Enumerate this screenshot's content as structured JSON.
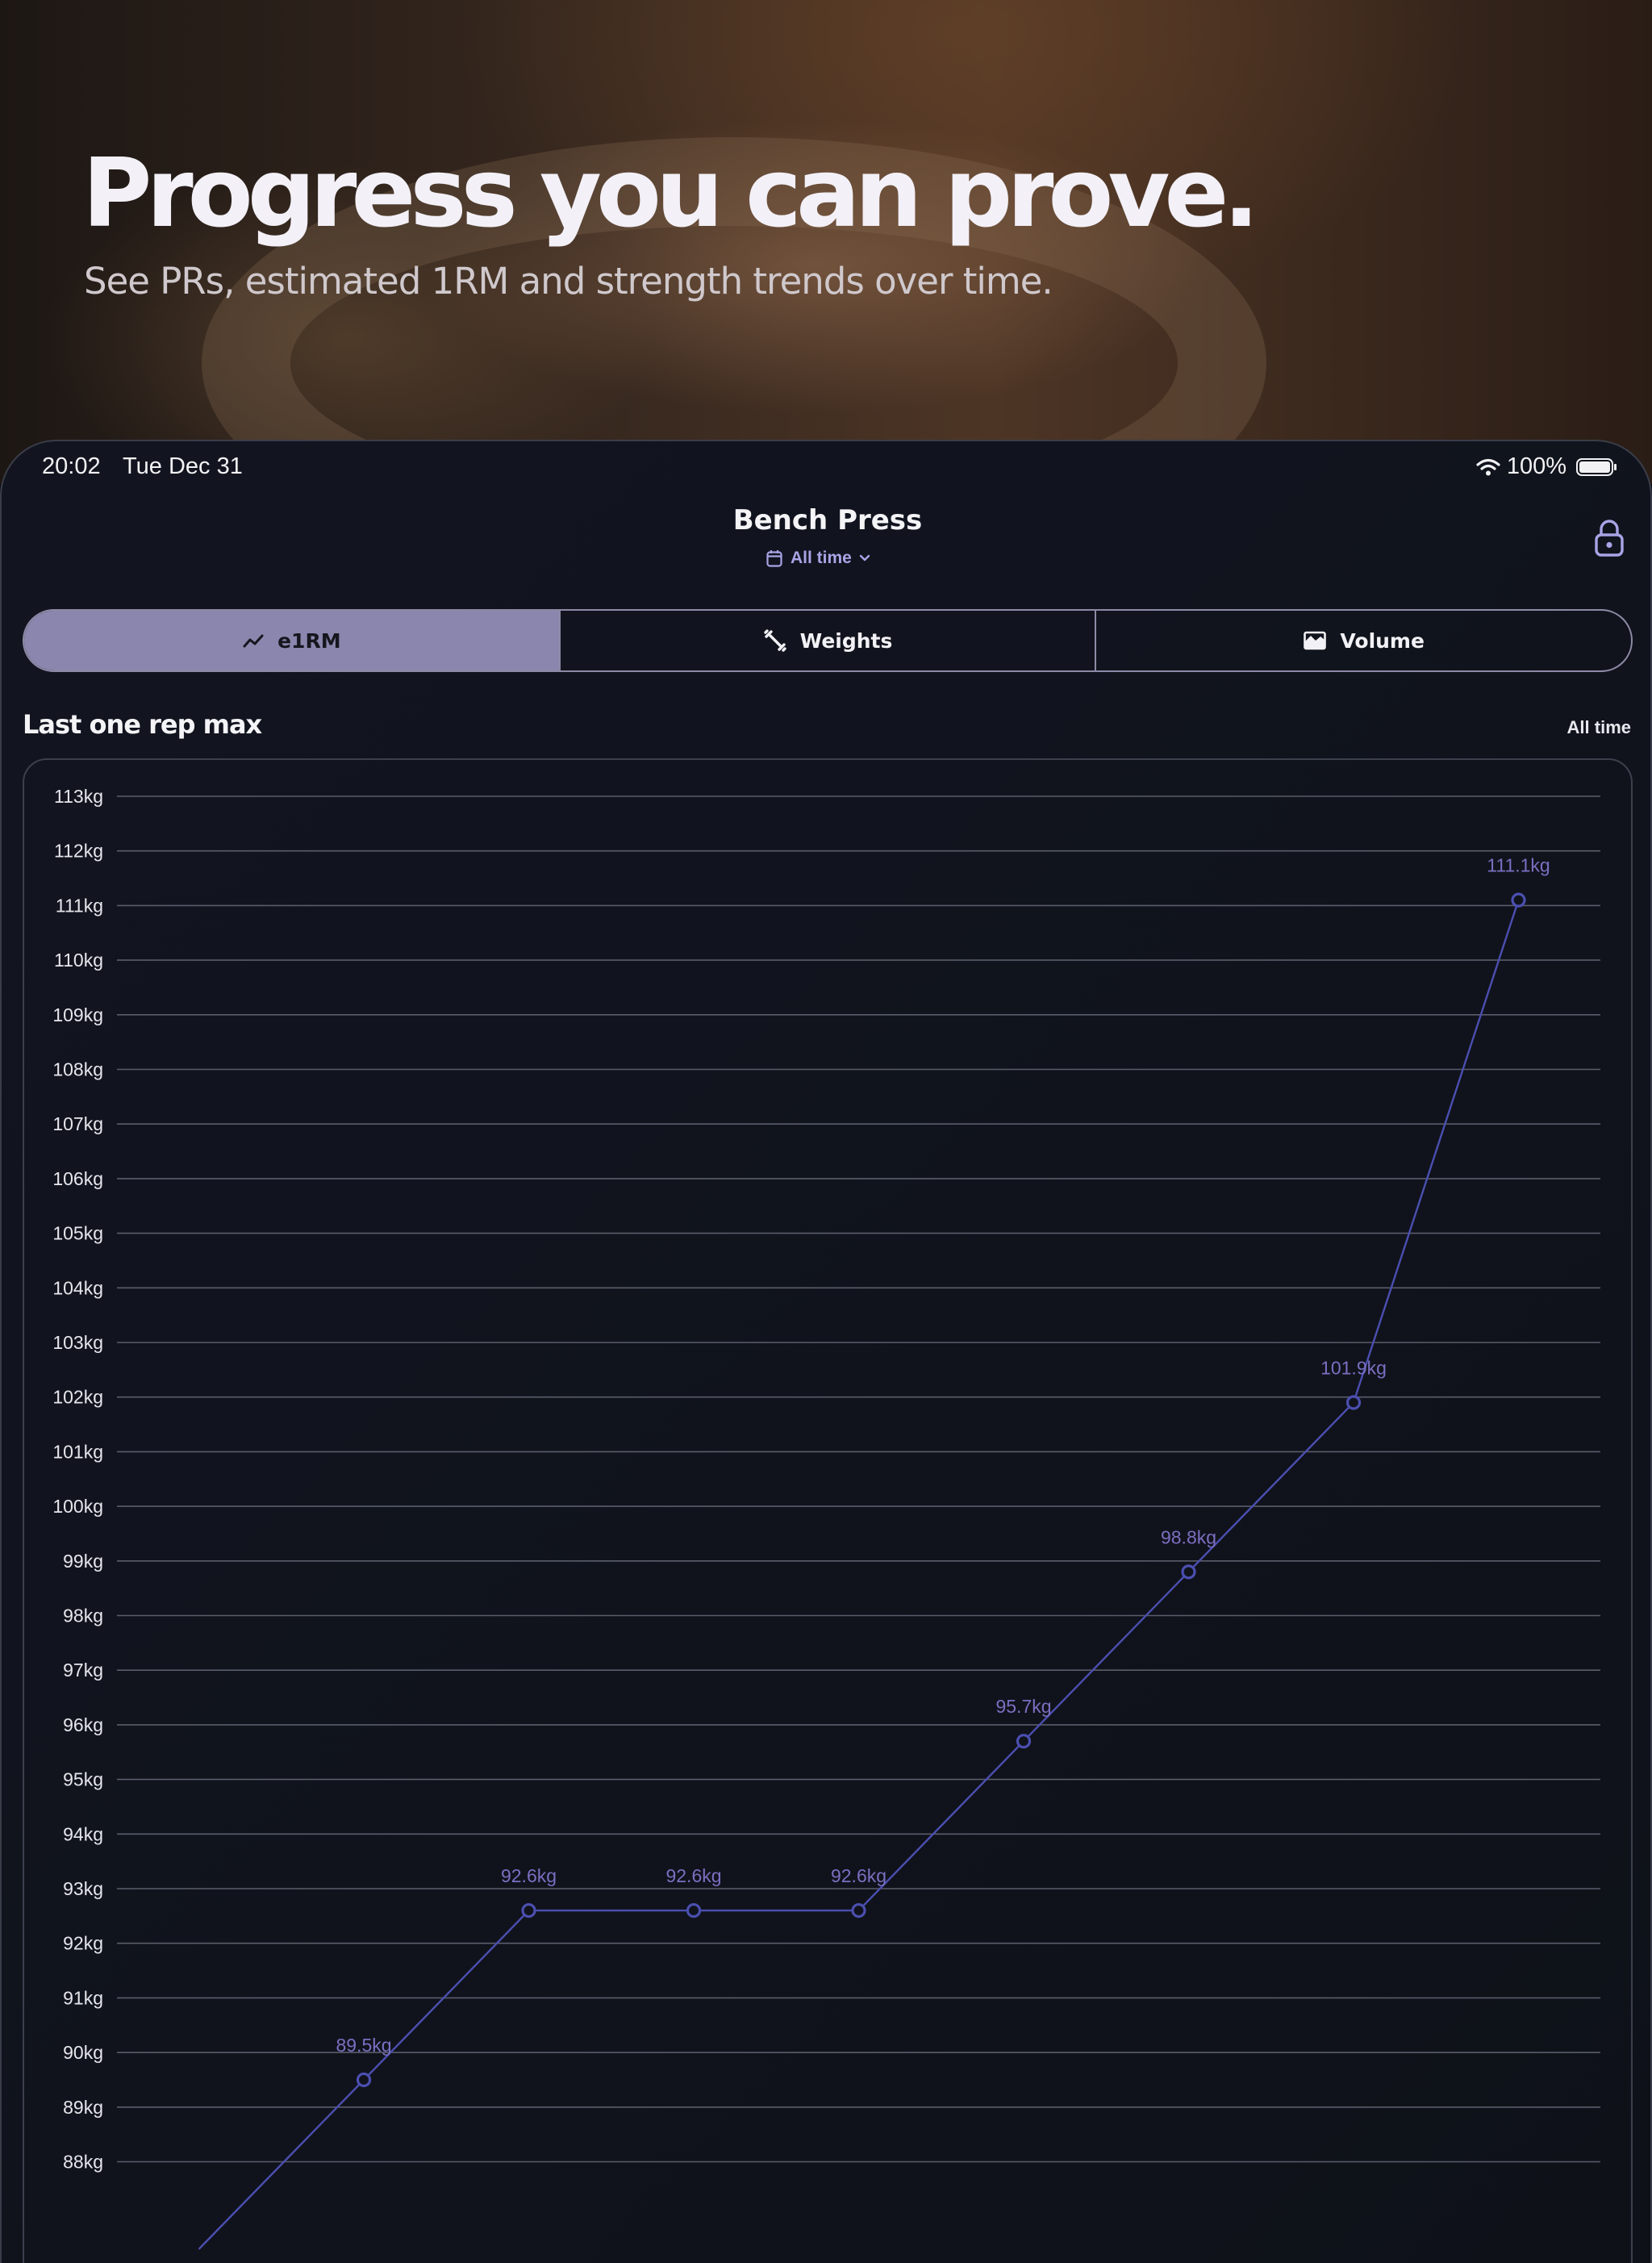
{
  "hero": {
    "title": "Progress you can prove.",
    "subtitle": "See PRs, estimated 1RM and strength trends over time."
  },
  "status_bar": {
    "time": "20:02",
    "date": "Tue Dec 31",
    "battery": "100%",
    "icons": [
      "wifi-icon",
      "battery-icon"
    ]
  },
  "nav": {
    "title": "Bench Press",
    "range": "All time",
    "icons": [
      "calendar-icon",
      "chevron-down-icon",
      "lock-icon"
    ]
  },
  "tabs": [
    {
      "label": "e1RM",
      "icon": "trend-line-icon",
      "active": true
    },
    {
      "label": "Weights",
      "icon": "dumbbell-icon",
      "active": false
    },
    {
      "label": "Volume",
      "icon": "area-chart-icon",
      "active": false
    }
  ],
  "section": {
    "title": "Last one rep max",
    "range": "All time"
  },
  "colors": {
    "accent": "#8b86ad",
    "line": "#4b4fb0",
    "point_label": "#7a6fc2"
  },
  "chart_data": {
    "type": "line",
    "ylabel_unit": "kg",
    "ylim": [
      87,
      113
    ],
    "yticks": [
      "113kg",
      "112kg",
      "111kg",
      "110kg",
      "109kg",
      "108kg",
      "107kg",
      "106kg",
      "105kg",
      "104kg",
      "103kg",
      "102kg",
      "101kg",
      "100kg",
      "99kg",
      "98kg",
      "97kg",
      "96kg",
      "95kg",
      "94kg",
      "93kg",
      "92kg",
      "91kg",
      "90kg",
      "89kg",
      "88kg"
    ],
    "grid": true,
    "series": [
      {
        "values": [
          89.5,
          92.6,
          92.6,
          92.6,
          95.7,
          98.8,
          101.9,
          111.1
        ],
        "labels": [
          "89.5kg",
          "92.6kg",
          "92.6kg",
          "92.6kg",
          "95.7kg",
          "98.8kg",
          "101.9kg",
          "111.1kg"
        ]
      }
    ]
  }
}
